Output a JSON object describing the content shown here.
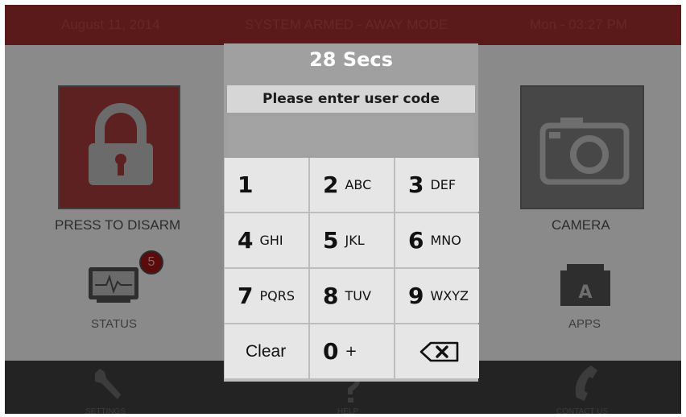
{
  "topbar": {
    "date": "August 11, 2014",
    "status": "SYSTEM ARMED - AWAY MODE",
    "time": "Mon - 03:27 PM"
  },
  "home": {
    "disarm_label": "PRESS TO DISARM",
    "camera_label": "CAMERA",
    "status_label": "STATUS",
    "status_badge": "5",
    "apps_label": "APPS",
    "apps_icon_letter": "A"
  },
  "bottombar": {
    "settings_label": "SETTINGS",
    "help_label": "HELP",
    "contact_label": "CONTACT US"
  },
  "keypad": {
    "timer": "28  Secs",
    "prompt": "Please enter user code",
    "keys": [
      {
        "digit": "1",
        "letters": ""
      },
      {
        "digit": "2",
        "letters": "ABC"
      },
      {
        "digit": "3",
        "letters": "DEF"
      },
      {
        "digit": "4",
        "letters": "GHI"
      },
      {
        "digit": "5",
        "letters": "JKL"
      },
      {
        "digit": "6",
        "letters": "MNO"
      },
      {
        "digit": "7",
        "letters": "PQRS"
      },
      {
        "digit": "8",
        "letters": "TUV"
      },
      {
        "digit": "9",
        "letters": "WXYZ"
      }
    ],
    "clear_label": "Clear",
    "zero_digit": "0",
    "zero_symbol": "+"
  },
  "icons": {
    "lock": "lock-icon",
    "camera": "camera-icon",
    "status": "monitor-pulse-icon",
    "apps": "apps-folder-icon",
    "settings": "wrench-icon",
    "help": "question-icon",
    "contact": "phone-icon",
    "backspace": "backspace-icon"
  },
  "colors": {
    "armed_red": "#5a1a1a",
    "dialog_gray": "#a0a0a0",
    "key_bg": "#e6e6e6"
  }
}
